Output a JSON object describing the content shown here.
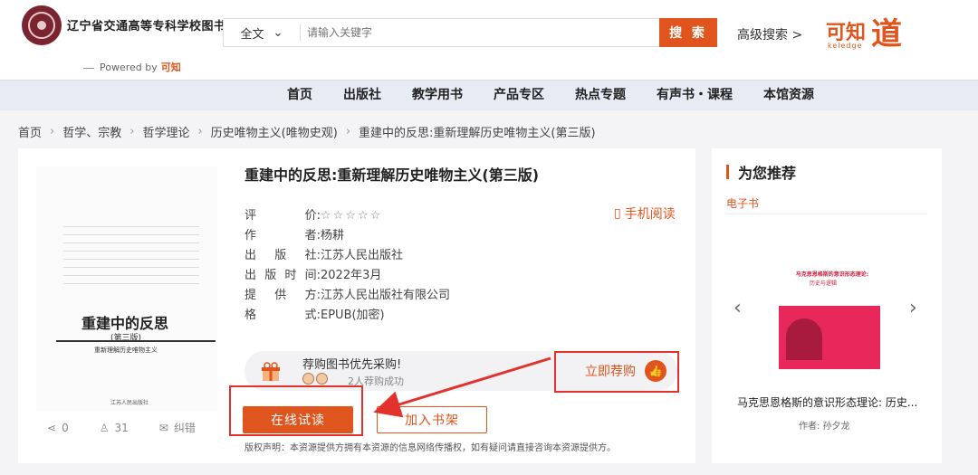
{
  "header": {
    "library_name": "辽宁省交通高等专科学校图书馆",
    "powered_by": "Powered by",
    "powered_brand": "可知",
    "search_scope": "全文",
    "search_placeholder": "请输入关键字",
    "search_button": "搜 索",
    "advanced_search": "高级搜索 >",
    "brand_text": "可知",
    "brand_sub": "keledge"
  },
  "nav": {
    "items": [
      "首页",
      "出版社",
      "教学用书",
      "产品专区",
      "热点专题",
      "有声书・课程",
      "本馆资源"
    ]
  },
  "breadcrumb": {
    "items": [
      "首页",
      "哲学、宗教",
      "哲学理论",
      "历史唯物主义(唯物史观)",
      "重建中的反思:重新理解历史唯物主义(第三版)"
    ]
  },
  "book": {
    "title": "重建中的反思:重新理解历史唯物主义(第三版)",
    "rating_label": [
      "评",
      "价:"
    ],
    "rating_stars": "☆☆☆☆☆",
    "author_label": [
      "作",
      "者:"
    ],
    "author": "杨耕",
    "publisher_label": [
      "出",
      "版",
      "社:"
    ],
    "publisher": "江苏人民出版社",
    "date_label": [
      "出",
      "版",
      "时",
      "间:"
    ],
    "date": "2022年3月",
    "provider_label": [
      "提",
      "供",
      "方:"
    ],
    "provider": "江苏人民出版社有限公司",
    "format_label": [
      "格",
      "式:"
    ],
    "format": "EPUB(加密)",
    "mobile_read": "手机阅读",
    "cover_title": "重建中的反思",
    "cover_edition": "(第三版)",
    "cover_subtitle": "重新理解历史唯物主义",
    "cover_publisher": "江苏人民出版社"
  },
  "stats": {
    "shares": "0",
    "users": "31",
    "report": "纠错"
  },
  "recommend": {
    "title": "荐购图书优先采购!",
    "count": "2人荐购成功",
    "button": "立即荐购"
  },
  "actions": {
    "read_online": "在线试读",
    "add_shelf": "加入书架"
  },
  "copyright": "版权声明：本资源提供方拥有本资源的信息网络传播权，如有疑问请直接咨询本资源提供方。",
  "sidebar": {
    "heading": "为您推荐",
    "tab": "电子书",
    "book_title": "马克思恩格斯的意识形态理论: 历史...",
    "author": "作者:  孙夕龙",
    "cover_title": "马克思恩格斯的意识形态理论:",
    "cover_sub": "历史与逻辑"
  },
  "colors": {
    "accent": "#e0541d",
    "highlight_red": "#e3312b",
    "nav_bg": "#e8ebf4"
  }
}
